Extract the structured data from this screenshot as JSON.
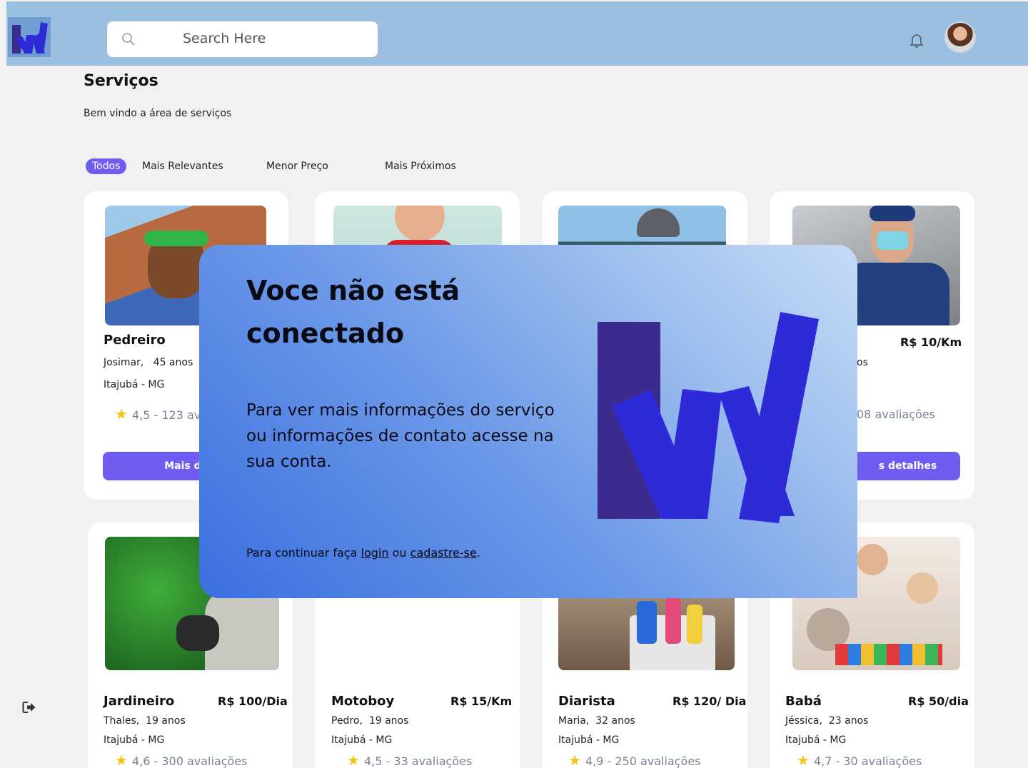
{
  "header": {
    "search_placeholder": "Search Here",
    "brand_colors": {
      "bar": "#9abfe0",
      "accent": "#6f5cf0"
    }
  },
  "page": {
    "title": "Serviços",
    "subtitle": "Bem vindo a área de serviços"
  },
  "filters": [
    {
      "label": "Todos",
      "active": true
    },
    {
      "label": "Mais Relevantes",
      "active": false
    },
    {
      "label": "Menor Preço",
      "active": false
    },
    {
      "label": "Mais Próximos",
      "active": false
    }
  ],
  "cards": [
    {
      "title": "Pedreiro",
      "name": "Josimar,",
      "age": "45 anos",
      "location": "Itajubá - MG",
      "rating": "4,5 - 123 avaliações",
      "button": "Mais detalhes"
    },
    {
      "title": "",
      "price": ""
    },
    {
      "title": "",
      "price": ""
    },
    {
      "price": "R$ 10/Km",
      "age_fragment": "os",
      "rating_fragment": "08 avaliações",
      "button_fragment": "s detalhes"
    },
    {
      "title": "Jardineiro",
      "price": "R$ 100/Dia",
      "name": "Thales,",
      "age": "19 anos",
      "location": "Itajubá - MG",
      "rating": "4,6 - 300 avaliações"
    },
    {
      "title": "Motoboy",
      "price": "R$ 15/Km",
      "name": "Pedro,",
      "age": "19 anos",
      "location": "Itajubá - MG",
      "rating": "4,5 - 33 avaliações"
    },
    {
      "title": "Diarista",
      "price": "R$ 120/ Dia",
      "name": "Maria,",
      "age": "32 anos",
      "location": "Itajubá - MG",
      "rating": "4,9 - 250 avaliações"
    },
    {
      "title": "Babá",
      "price": "R$ 50/dia",
      "name": "Jéssica,",
      "age": "23 anos",
      "location": "Itajubá - MG",
      "rating": "4,7 - 30 avaliações"
    }
  ],
  "card1_visible": {
    "rating": "4,5 - 123 ava",
    "button": "Mais det"
  },
  "modal": {
    "title": "Voce não está conectado",
    "body": "Para ver mais informações do serviço ou informações de contato acesse na sua conta.",
    "footer_prefix": "Para continuar faça",
    "login_link": "login",
    "footer_middle": "ou",
    "signup_link": "cadastre-se",
    "footer_suffix": "."
  },
  "icons": [
    "search-icon",
    "bell-icon",
    "logout-icon",
    "star-icon",
    "brand-logo"
  ]
}
